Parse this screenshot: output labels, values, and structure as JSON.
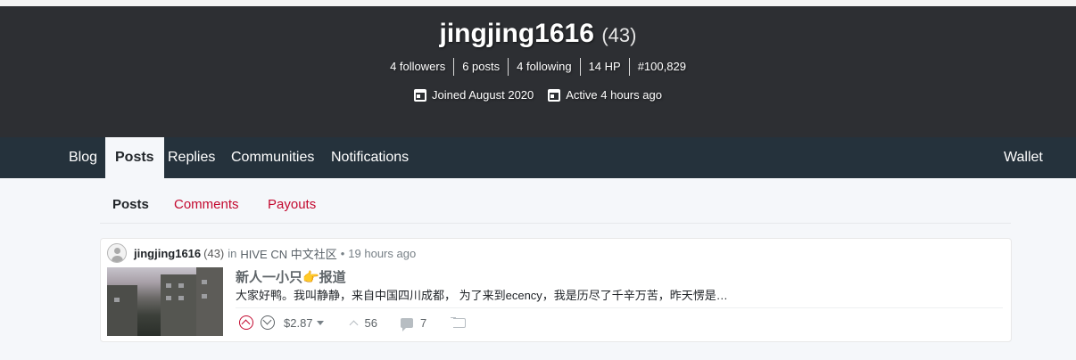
{
  "profile": {
    "username": "jingjing1616",
    "reputation": "(43)",
    "stats": {
      "followers": "4 followers",
      "posts": "6 posts",
      "following": "4 following",
      "hp": "14 HP",
      "rank": "#100,829"
    },
    "joined": "Joined August 2020",
    "active": "Active 4 hours ago"
  },
  "nav": {
    "tabs": [
      "Blog",
      "Posts",
      "Replies",
      "Communities",
      "Notifications"
    ],
    "active_tab": "Posts",
    "wallet": "Wallet"
  },
  "sub_tabs": {
    "items": [
      "Posts",
      "Comments",
      "Payouts"
    ],
    "active": "Posts"
  },
  "post": {
    "author": "jingjing1616",
    "author_rep": "(43)",
    "in_label": "in",
    "community": "HIVE CN 中文社区",
    "separator": "•",
    "time": "19 hours ago",
    "title": "新人一小只👉报道",
    "excerpt": "大家好鸭。我叫静静，来自中国四川成都， 为了来到ecency，我是历尽了千辛万苦，昨天愣是…",
    "payout": "$2.87",
    "votes": "56",
    "comments": "7"
  },
  "colors": {
    "header_bg": "#2d2f33",
    "nav_bg": "#25323c",
    "accent": "#c3092f",
    "page_bg": "#f5f7fa"
  }
}
